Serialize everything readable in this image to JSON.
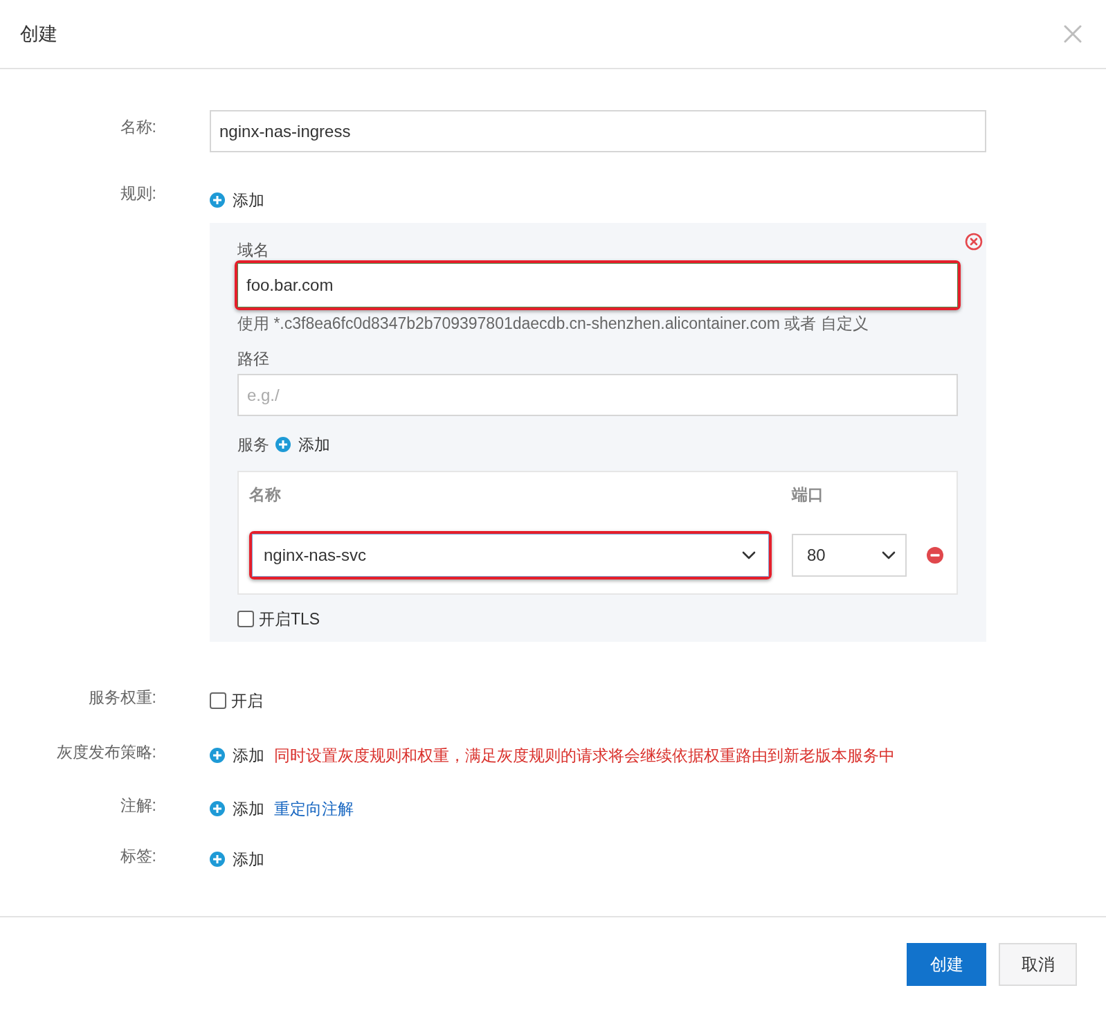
{
  "dialog": {
    "title": "创建"
  },
  "form": {
    "name": {
      "label": "名称:",
      "value": "nginx-nas-ingress"
    },
    "rules": {
      "label": "规则:",
      "add_label": "添加",
      "items": [
        {
          "domain": {
            "label": "域名",
            "value": "foo.bar.com",
            "highlighted": true
          },
          "hint": "使用 *.c3f8ea6fc0d8347b2b709397801daecdb.cn-shenzhen.alicontainer.com 或者 自定义",
          "path": {
            "label": "路径",
            "placeholder": "e.g./"
          },
          "services": {
            "label": "服务",
            "add_label": "添加",
            "columns": [
              "名称",
              "端口"
            ],
            "rows": [
              {
                "name": "nginx-nas-svc",
                "port": "80",
                "highlighted": true
              }
            ]
          },
          "tls": {
            "label": "开启TLS",
            "checked": false
          }
        }
      ]
    },
    "service_weight": {
      "label": "服务权重:",
      "option": {
        "label": "开启",
        "checked": false
      }
    },
    "canary": {
      "label": "灰度发布策略:",
      "add_label": "添加",
      "note": "同时设置灰度规则和权重，满足灰度规则的请求将会继续依据权重路由到新老版本服务中"
    },
    "annotations": {
      "label": "注解:",
      "add_label": "添加",
      "link": "重定向注解"
    },
    "tags": {
      "label": "标签:",
      "add_label": "添加"
    }
  },
  "footer": {
    "buttons": [
      {
        "label": "创建",
        "kind": "primary"
      },
      {
        "label": "取消",
        "kind": "default"
      }
    ]
  }
}
